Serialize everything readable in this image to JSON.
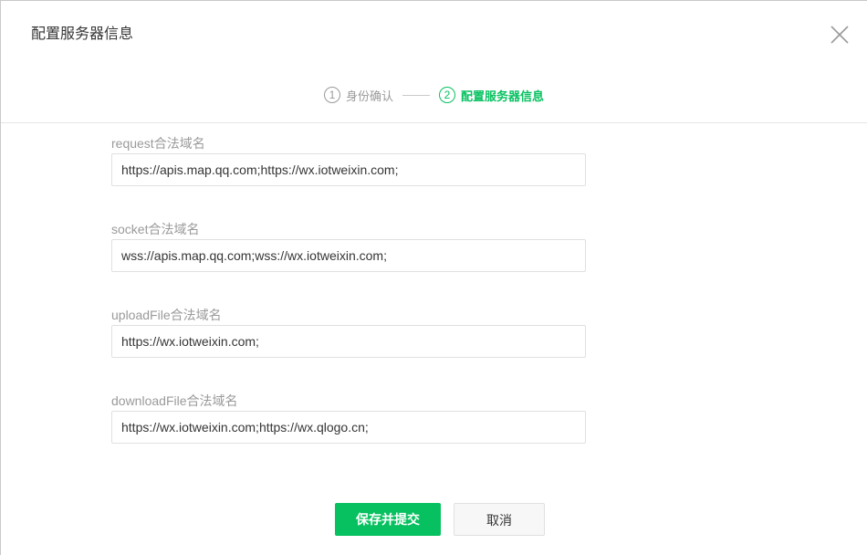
{
  "dialog": {
    "title": "配置服务器信息",
    "close_icon": "close-icon"
  },
  "steps": [
    {
      "num": "1",
      "label": "身份确认",
      "active": false
    },
    {
      "num": "2",
      "label": "配置服务器信息",
      "active": true
    }
  ],
  "fields": [
    {
      "label": "request合法域名",
      "value": "https://apis.map.qq.com;https://wx.iotweixin.com;"
    },
    {
      "label": "socket合法域名",
      "value": "wss://apis.map.qq.com;wss://wx.iotweixin.com;"
    },
    {
      "label": "uploadFile合法域名",
      "value": "https://wx.iotweixin.com;"
    },
    {
      "label": "downloadFile合法域名",
      "value": "https://wx.iotweixin.com;https://wx.qlogo.cn;"
    }
  ],
  "buttons": {
    "submit_label": "保存并提交",
    "cancel_label": "取消"
  },
  "colors": {
    "accent": "#07c160",
    "muted": "#9a9a9a"
  }
}
